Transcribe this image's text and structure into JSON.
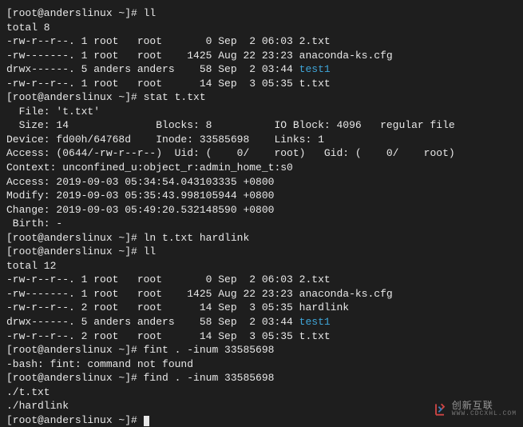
{
  "prompt": {
    "open": "[",
    "user": "root@anderslinux",
    "path": " ~",
    "close": "]#",
    "full": "[root@anderslinux ~]# "
  },
  "lines": {
    "l0": "[root@anderslinux ~]# ll",
    "l1": "total 8",
    "l2": "-rw-r--r--. 1 root   root       0 Sep  2 06:03 2.txt",
    "l3": "-rw-------. 1 root   root    1425 Aug 22 23:23 anaconda-ks.cfg",
    "l4a": "drwx------. 5 anders anders    58 Sep  2 03:44 ",
    "l4b": "test1",
    "l5": "-rw-r--r--. 1 root   root      14 Sep  3 05:35 t.txt",
    "l6": "[root@anderslinux ~]# stat t.txt",
    "l7": "  File: 't.txt'",
    "l8": "  Size: 14              Blocks: 8          IO Block: 4096   regular file",
    "l9": "Device: fd00h/64768d    Inode: 33585698    Links: 1",
    "l10": "Access: (0644/-rw-r--r--)  Uid: (    0/    root)   Gid: (    0/    root)",
    "l11": "Context: unconfined_u:object_r:admin_home_t:s0",
    "l12": "Access: 2019-09-03 05:34:54.043103335 +0800",
    "l13": "Modify: 2019-09-03 05:35:43.998105944 +0800",
    "l14": "Change: 2019-09-03 05:49:20.532148590 +0800",
    "l15": " Birth: -",
    "l16": "[root@anderslinux ~]# ln t.txt hardlink",
    "l17": "[root@anderslinux ~]# ll",
    "l18": "total 12",
    "l19": "-rw-r--r--. 1 root   root       0 Sep  2 06:03 2.txt",
    "l20": "-rw-------. 1 root   root    1425 Aug 22 23:23 anaconda-ks.cfg",
    "l21": "-rw-r--r--. 2 root   root      14 Sep  3 05:35 hardlink",
    "l22a": "drwx------. 5 anders anders    58 Sep  2 03:44 ",
    "l22b": "test1",
    "l23": "-rw-r--r--. 2 root   root      14 Sep  3 05:35 t.txt",
    "l24": "[root@anderslinux ~]# fint . -inum 33585698",
    "l25": "-bash: fint: command not found",
    "l26": "[root@anderslinux ~]# find . -inum 33585698",
    "l27": "./t.txt",
    "l28": "./hardlink",
    "l29": "[root@anderslinux ~]# "
  },
  "watermark": {
    "cn": "创新互联",
    "domain": "WWW.CDCXHL.COM"
  }
}
